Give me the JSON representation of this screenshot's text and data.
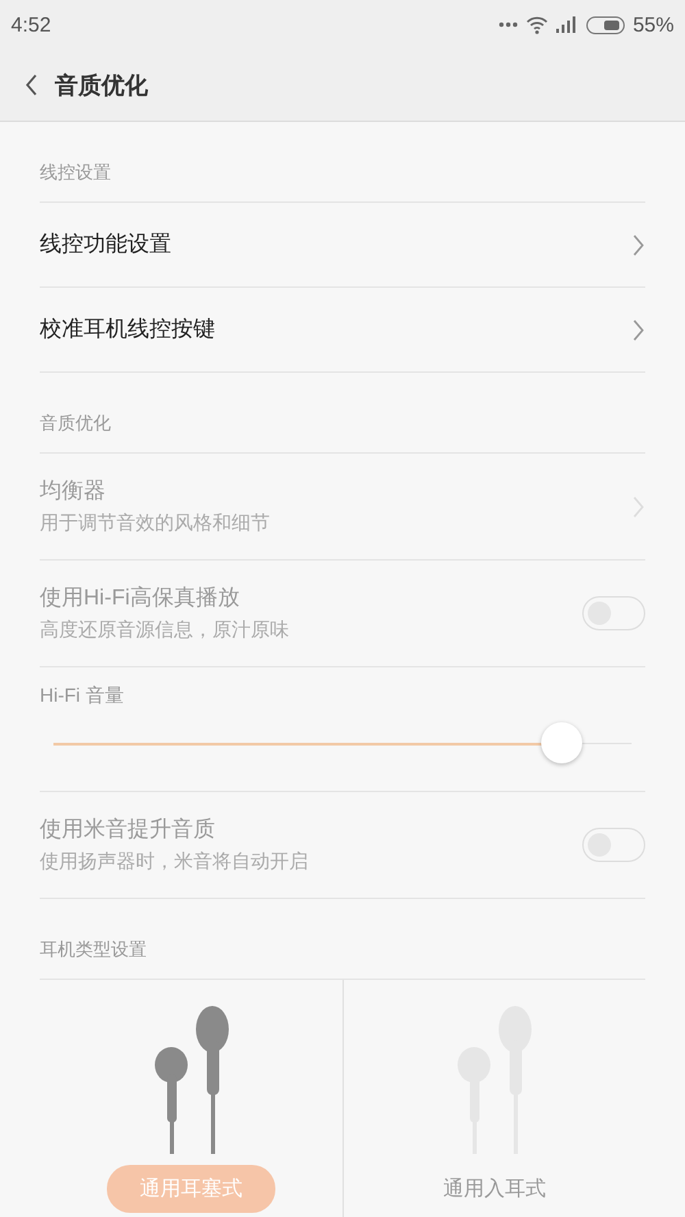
{
  "status_bar": {
    "time": "4:52",
    "battery": "55%"
  },
  "header": {
    "title": "音质优化"
  },
  "sections": [
    {
      "title": "线控设置",
      "items": [
        {
          "kind": "link",
          "title": "线控功能设置",
          "disabled": false
        },
        {
          "kind": "link",
          "title": "校准耳机线控按键",
          "disabled": false
        }
      ]
    },
    {
      "title": "音质优化",
      "items": [
        {
          "kind": "link",
          "title": "均衡器",
          "subtitle": "用于调节音效的风格和细节",
          "disabled": true
        },
        {
          "kind": "toggle",
          "title": "使用Hi-Fi高保真播放",
          "subtitle": "高度还原音源信息，原汁原味",
          "on": false,
          "disabled": true
        },
        {
          "kind": "slider",
          "title": "Hi-Fi 音量",
          "level": 0.88,
          "disabled": true
        },
        {
          "kind": "toggle",
          "title": "使用米音提升音质",
          "subtitle": "使用扬声器时，米音将自动开启",
          "on": false,
          "disabled": true
        }
      ]
    },
    {
      "title": "耳机类型设置"
    }
  ],
  "earphone_types": [
    {
      "label": "通用耳塞式",
      "selected": true
    },
    {
      "label": "通用入耳式",
      "selected": false
    }
  ]
}
